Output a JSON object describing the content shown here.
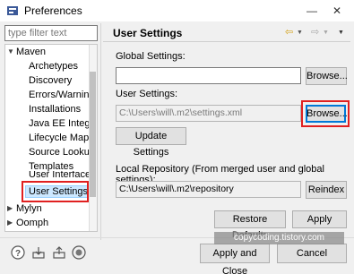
{
  "window": {
    "title": "Preferences"
  },
  "filter": {
    "placeholder": "type filter text"
  },
  "tree": {
    "items": [
      {
        "label": "Maven"
      },
      {
        "label": "Archetypes"
      },
      {
        "label": "Discovery"
      },
      {
        "label": "Errors/Warnings"
      },
      {
        "label": "Installations"
      },
      {
        "label": "Java EE Integration"
      },
      {
        "label": "Lifecycle Mappings"
      },
      {
        "label": "Source Lookup"
      },
      {
        "label": "Templates"
      },
      {
        "label": "User Interface"
      },
      {
        "label": "User Settings"
      },
      {
        "label": "Mylyn"
      },
      {
        "label": "Oomph"
      }
    ]
  },
  "page": {
    "title": "User Settings",
    "global_label": "Global Settings:",
    "global_value": "",
    "browse_label": "Browse...",
    "user_label": "User Settings:",
    "user_value": "C:\\Users\\will\\.m2\\settings.xml",
    "update_label": "Update Settings",
    "local_repo_label": "Local Repository (From merged user and global settings):",
    "local_repo_value": "C:\\Users\\will\\.m2\\repository",
    "reindex_label": "Reindex",
    "restore_label": "Restore Defaults",
    "apply_label": "Apply"
  },
  "footer": {
    "apply_close_label": "Apply and Close",
    "cancel_label": "Cancel"
  },
  "watermark": {
    "text": "copycoding.tistory.com"
  }
}
